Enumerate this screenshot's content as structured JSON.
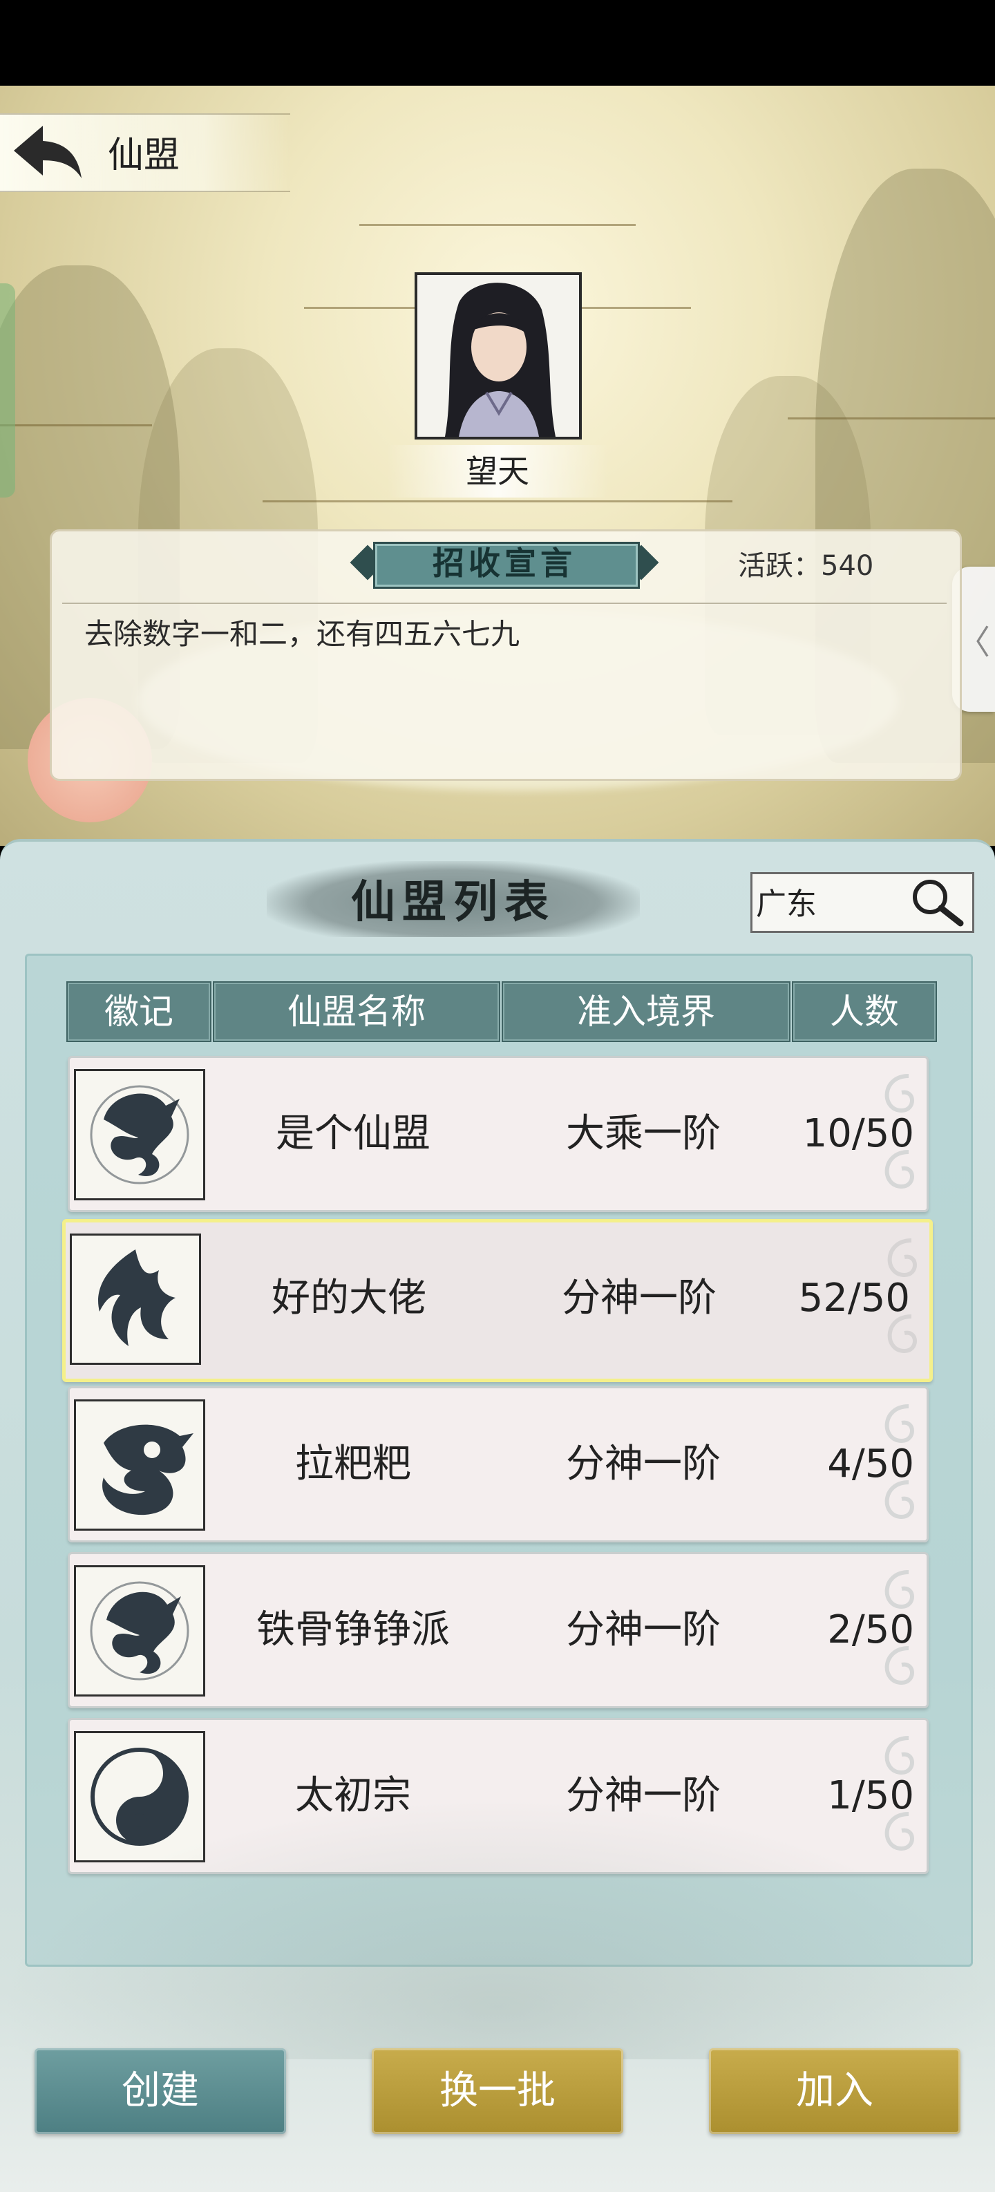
{
  "header": {
    "title": "仙盟"
  },
  "leader": {
    "name": "望天"
  },
  "declaration": {
    "title": "招收宣言",
    "activity": "活跃：540",
    "text": "去除数字一和二，还有四五六七九"
  },
  "list": {
    "title": "仙盟列表",
    "search": {
      "value": "广东"
    },
    "columns": [
      "徽记",
      "仙盟名称",
      "准入境界",
      "人数"
    ],
    "rows": [
      {
        "emblem": "dragon-emblem-icon",
        "name": "是个仙盟",
        "realm": "大乘一阶",
        "members": "10/50",
        "selected": false
      },
      {
        "emblem": "phoenix-emblem-icon",
        "name": "好的大佬",
        "realm": "分神一阶",
        "members": "52/50",
        "selected": true
      },
      {
        "emblem": "coiled-dragon-emblem-icon",
        "name": "拉粑粑",
        "realm": "分神一阶",
        "members": "4/50",
        "selected": false
      },
      {
        "emblem": "dragon-emblem-icon",
        "name": "铁骨铮铮派",
        "realm": "分神一阶",
        "members": "2/50",
        "selected": false
      },
      {
        "emblem": "yin-yang-emblem-icon",
        "name": "太初宗",
        "realm": "分神一阶",
        "members": "1/50",
        "selected": false
      }
    ]
  },
  "buttons": {
    "create": "创建",
    "refresh": "换一批",
    "join": "加入"
  },
  "colors": {
    "teal": "#5f8585",
    "gold": "#b8993a",
    "selection": "#f4f08a"
  }
}
